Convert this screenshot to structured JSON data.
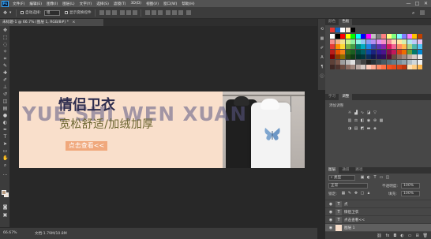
{
  "app": {
    "logo": "Ps"
  },
  "menu": [
    "文件(F)",
    "编辑(E)",
    "图像(I)",
    "图层(L)",
    "文字(Y)",
    "选择(S)",
    "滤镜(T)",
    "3D(D)",
    "视图(V)",
    "窗口(W)",
    "帮助(H)"
  ],
  "window_controls": {
    "minimize": "—",
    "maximize": "□",
    "close": "✕"
  },
  "options": {
    "auto_select_label": "自动选择:",
    "auto_select_value": "组",
    "show_transform_label": "显示变换控件"
  },
  "document_tab": {
    "title": "未标题-1 @ 66.7% (图层 1, RGB/8#) *",
    "close": "×"
  },
  "artwork": {
    "watermark": "YUE SHI WEN XUAN",
    "title": "情侣卫衣",
    "subtitle": "宽松舒适/加绒加厚",
    "cta": "点击查看<<",
    "colors": {
      "background": "#f9dfcb",
      "cta": "#f0a87c",
      "title": "#2d2c4e",
      "subtitle": "#6b6530",
      "watermark": "#5c5986"
    }
  },
  "status": {
    "zoom": "66.67%",
    "doc_info": "文档:1.79M/10.8M"
  },
  "swatches": {
    "tabs": [
      {
        "label": "颜色",
        "active": false
      },
      {
        "label": "色板",
        "active": true
      }
    ],
    "recent": [
      "#e53935",
      "#1565c0",
      "#ffffff",
      "#f3e3d3",
      "#000000"
    ],
    "grid": [
      "#ffffff",
      "#000000",
      "#ff0000",
      "#ffff00",
      "#00ff00",
      "#00ffff",
      "#0000ff",
      "#ff00ff",
      "#c0c0c0",
      "#808080",
      "#ff8080",
      "#ffff80",
      "#80ff80",
      "#80ffff",
      "#8080ff",
      "#ff80ff",
      "#ffc000",
      "#c04000",
      "#f28e8e",
      "#f2b48e",
      "#f2e08e",
      "#c8f28e",
      "#8ef2a0",
      "#8ef2e0",
      "#8ec8f2",
      "#8e9af2",
      "#b48ef2",
      "#e08ef2",
      "#f28ec8",
      "#f28e9a",
      "#ffd7b5",
      "#ffe8a0",
      "#d4f0b0",
      "#b0e8f0",
      "#c0c8f8",
      "#e8c0f0",
      "#e53935",
      "#fb8c00",
      "#fdd835",
      "#7cb342",
      "#43a047",
      "#00897b",
      "#00acc1",
      "#1e88e5",
      "#3949ab",
      "#5e35b1",
      "#8e24aa",
      "#d81b60",
      "#f06292",
      "#ff8a65",
      "#ffb74d",
      "#aed581",
      "#4db6ac",
      "#4fc3f7",
      "#b71c1c",
      "#e65100",
      "#f57f17",
      "#33691e",
      "#1b5e20",
      "#004d40",
      "#006064",
      "#0d47a1",
      "#1a237e",
      "#311b92",
      "#4a148c",
      "#880e4f",
      "#c2185b",
      "#d84315",
      "#ef6c00",
      "#689f38",
      "#00796b",
      "#0288d1",
      "#7f0000",
      "#8d3b00",
      "#8c6d00",
      "#2e4a12",
      "#0f3d14",
      "#00332b",
      "#00363d",
      "#0a2e5c",
      "#10164f",
      "#21125e",
      "#300d5c",
      "#5c0a33",
      "#6d4c41",
      "#8d6e63",
      "#a1887f",
      "#bcaaa4",
      "#d7ccc8",
      "#efebe9",
      "#5d4037",
      "#795548",
      "#9e9e9e",
      "#bdbdbd",
      "#e0e0e0",
      "#616161",
      "#424242",
      "#212121",
      "#263238",
      "#37474f",
      "#455a64",
      "#546e7a",
      "#607d8b",
      "#78909c",
      "#90a4ae",
      "#b0bec5",
      "#cfd8dc",
      "#eceff1",
      "#3e2723",
      "#4e342e",
      "#6d4c41",
      "#8d6e63",
      "#a1887f",
      "#bcaaa4",
      "#d7ccc8",
      "#ffccbc",
      "#ffab91",
      "#ff8a65",
      "#ff7043",
      "#f4511e",
      "#e64a19",
      "#d84315",
      "#bf360c",
      "#ffe0b2",
      "#ffcc80",
      "#ffb74d"
    ]
  },
  "adjustments": {
    "tabs": [
      {
        "label": "学习",
        "active": false
      },
      {
        "label": "调整",
        "active": true
      }
    ],
    "label": "添加调整"
  },
  "layers_panel": {
    "tabs": [
      {
        "label": "图层",
        "active": true
      },
      {
        "label": "通道",
        "active": false
      },
      {
        "label": "路径",
        "active": false
      }
    ],
    "kind_filter": "类型",
    "blend_mode": "正常",
    "opacity_label": "不透明度:",
    "opacity_value": "100%",
    "lock_label": "锁定:",
    "fill_label": "填充:",
    "fill_value": "100%",
    "layers": [
      {
        "name": "点",
        "type": "T",
        "selected": false
      },
      {
        "name": "情侣卫衣",
        "type": "T",
        "selected": false
      },
      {
        "name": "点击查看<<",
        "type": "T",
        "selected": false
      },
      {
        "name": "图层 1",
        "type": "img",
        "selected": true
      }
    ],
    "footer_icons": [
      "link-icon",
      "fx-icon",
      "mask-icon",
      "adjustment-icon",
      "folder-icon",
      "new-layer-icon",
      "trash-icon"
    ]
  }
}
